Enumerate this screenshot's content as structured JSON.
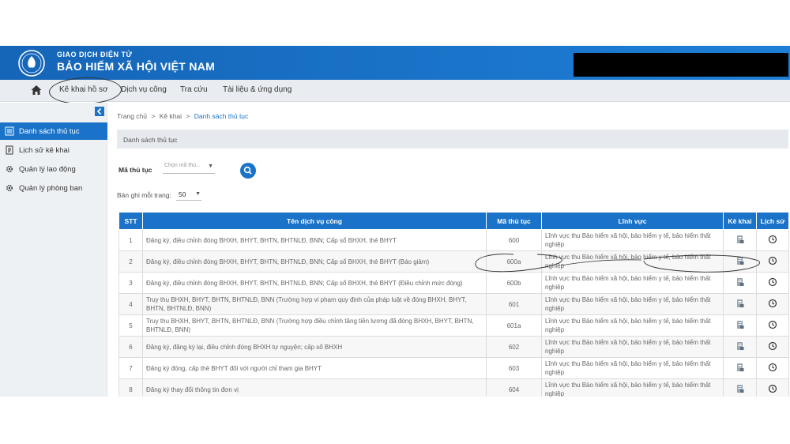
{
  "header": {
    "brand_sup": "GIAO DỊCH ĐIỆN TỬ",
    "brand_main": "BẢO HIỂM XÃ HỘI VIỆT NAM"
  },
  "nav": {
    "items": [
      {
        "label": "Kê khai hồ sơ"
      },
      {
        "label": "Dịch vụ công"
      },
      {
        "label": "Tra cứu"
      },
      {
        "label": "Tài liệu & ứng dụng"
      }
    ]
  },
  "sidebar": {
    "items": [
      {
        "label": "Danh sách thủ tục",
        "icon": "list-icon"
      },
      {
        "label": "Lịch sử kê khai",
        "icon": "history-doc-icon"
      },
      {
        "label": "Quản lý lao động",
        "icon": "gear-icon"
      },
      {
        "label": "Quản lý phòng ban",
        "icon": "gear-icon"
      }
    ]
  },
  "breadcrumb": {
    "home": "Trang chủ",
    "sep": ">",
    "level1": "Kê khai",
    "current": "Danh sách thủ tục"
  },
  "section_title": "Danh sách thủ tục",
  "filter": {
    "label": "Mã thủ tục",
    "placeholder": "Chọn mã thủ..."
  },
  "paging": {
    "label": "Bản ghi mỗi trang:",
    "value": "50"
  },
  "table": {
    "columns": [
      "STT",
      "Tên dịch vụ công",
      "Mã thủ tục",
      "Lĩnh vực",
      "Kê khai",
      "Lịch sử"
    ],
    "rows": [
      {
        "stt": "1",
        "name": "Đăng ký, điều chỉnh đóng BHXH, BHYT, BHTN, BHTNLĐ, BNN; Cấp sổ BHXH, thẻ BHYT",
        "code": "600",
        "field": "Lĩnh vực thu Bảo hiểm xã hội, bảo hiểm y tế, bảo hiểm thất nghiệp"
      },
      {
        "stt": "2",
        "name": "Đăng ký, điều chỉnh đóng BHXH, BHYT, BHTN, BHTNLĐ, BNN; Cấp sổ BHXH, thẻ BHYT (Báo giảm)",
        "code": "600a",
        "field": "Lĩnh vực thu Bảo hiểm xã hội, bảo hiểm y tế, bảo hiểm thất nghiệp"
      },
      {
        "stt": "3",
        "name": "Đăng ký, điều chỉnh đóng BHXH, BHYT, BHTN, BHTNLĐ, BNN; Cấp sổ BHXH, thẻ BHYT (Điều chỉnh mức đóng)",
        "code": "600b",
        "field": "Lĩnh vực thu Bảo hiểm xã hội, bảo hiểm y tế, bảo hiểm thất nghiệp"
      },
      {
        "stt": "4",
        "name": "Truy thu BHXH, BHYT, BHTN, BHTNLĐ, BNN (Trường hợp vi phạm quy định của pháp luật về đóng BHXH, BHYT, BHTN, BHTNLĐ, BNN)",
        "code": "601",
        "field": "Lĩnh vực thu Bảo hiểm xã hội, bảo hiểm y tế, bảo hiểm thất nghiệp"
      },
      {
        "stt": "5",
        "name": "Truy thu BHXH, BHYT, BHTN, BHTNLĐ, BNN (Trường hợp điều chỉnh tăng tiền lương đã đóng BHXH, BHYT, BHTN, BHTNLĐ, BNN)",
        "code": "601a",
        "field": "Lĩnh vực thu Bảo hiểm xã hội, bảo hiểm y tế, bảo hiểm thất nghiệp"
      },
      {
        "stt": "6",
        "name": "Đăng ký, đăng ký lại, điều chỉnh đóng BHXH tự nguyện; cấp sổ BHXH",
        "code": "602",
        "field": "Lĩnh vực thu Bảo hiểm xã hội, bảo hiểm y tế, bảo hiểm thất nghiệp"
      },
      {
        "stt": "7",
        "name": "Đăng ký đóng, cấp thẻ BHYT đối với người chỉ tham gia BHYT",
        "code": "603",
        "field": "Lĩnh vực thu Bảo hiểm xã hội, bảo hiểm y tế, bảo hiểm thất nghiệp"
      },
      {
        "stt": "8",
        "name": "Đăng ký thay đổi thông tin đơn vị",
        "code": "604",
        "field": "Lĩnh vực thu Bảo hiểm xã hội, bảo hiểm y tế, bảo hiểm thất nghiệp"
      }
    ]
  },
  "colors": {
    "brand_blue": "#1a73c8",
    "nav_bg": "#e9edf1",
    "sidebar_bg": "#eef1f4"
  }
}
